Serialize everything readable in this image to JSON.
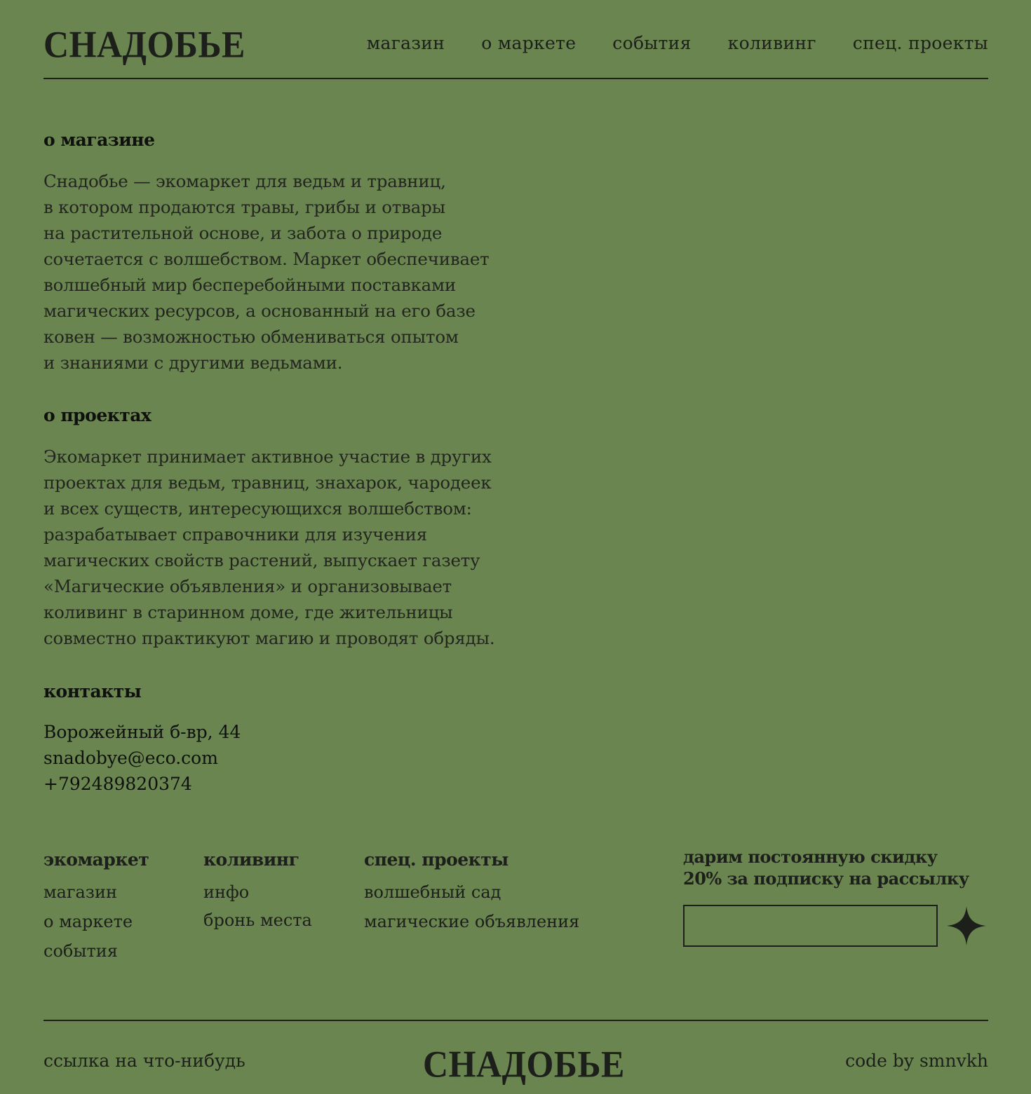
{
  "header": {
    "logo": "СНАДОБЬЕ",
    "nav": [
      "магазин",
      "о маркете",
      "события",
      "коливинг",
      "спец. проекты"
    ]
  },
  "about_shop": {
    "title": "о магазине",
    "lines": [
      "Снадобье — экомаркет для ведьм и травниц,",
      "в котором продаются травы, грибы и отвары",
      "на растительной основе, и забота о природе",
      "сочетается с волшебством. Маркет обеспечивает",
      "волшебный мир бесперебойными поставками",
      "магических ресурсов, а основанный на его базе",
      "ковен — возможностью обмениваться опытом",
      "и знаниями с другими ведьмами."
    ]
  },
  "about_projects": {
    "title": "о проектах",
    "lines": [
      "Экомаркет принимает активное участие в других",
      "проектах для ведьм, травниц, знахарок, чародеек",
      "и всех существ, интересующихся волшебством:",
      "разрабатывает справочники для изучения",
      "магических свойств растений, выпускает газету",
      "«Магические объявления» и организовывает",
      "коливинг в старинном доме, где жительницы",
      "совместно практикуют магию и проводят обряды."
    ]
  },
  "contacts": {
    "title": "контакты",
    "address": "Ворожейный б-вр, 44",
    "email": "snadobye@eco.com",
    "phone": "+792489820374"
  },
  "footer_columns": [
    {
      "heading": "экомаркет",
      "links": [
        "магазин",
        "о маркете",
        "события"
      ]
    },
    {
      "heading": "коливинг",
      "links": [
        "инфо",
        "бронь места"
      ]
    },
    {
      "heading": "спец. проекты",
      "links": [
        "волшебный сад",
        "магические объявления"
      ]
    }
  ],
  "subscribe": {
    "text_line1": "дарим постоянную скидку",
    "text_line2": "20% за подписку на рассылку",
    "input_value": "",
    "submit_icon": "four-point-star-icon"
  },
  "footer": {
    "link": "ссылка на что-нибудь",
    "logo": "СНАДОБЬЕ",
    "credit": "code by smnvkh"
  },
  "colors": {
    "background": "#6a8550",
    "ink": "#1d1f1a"
  }
}
